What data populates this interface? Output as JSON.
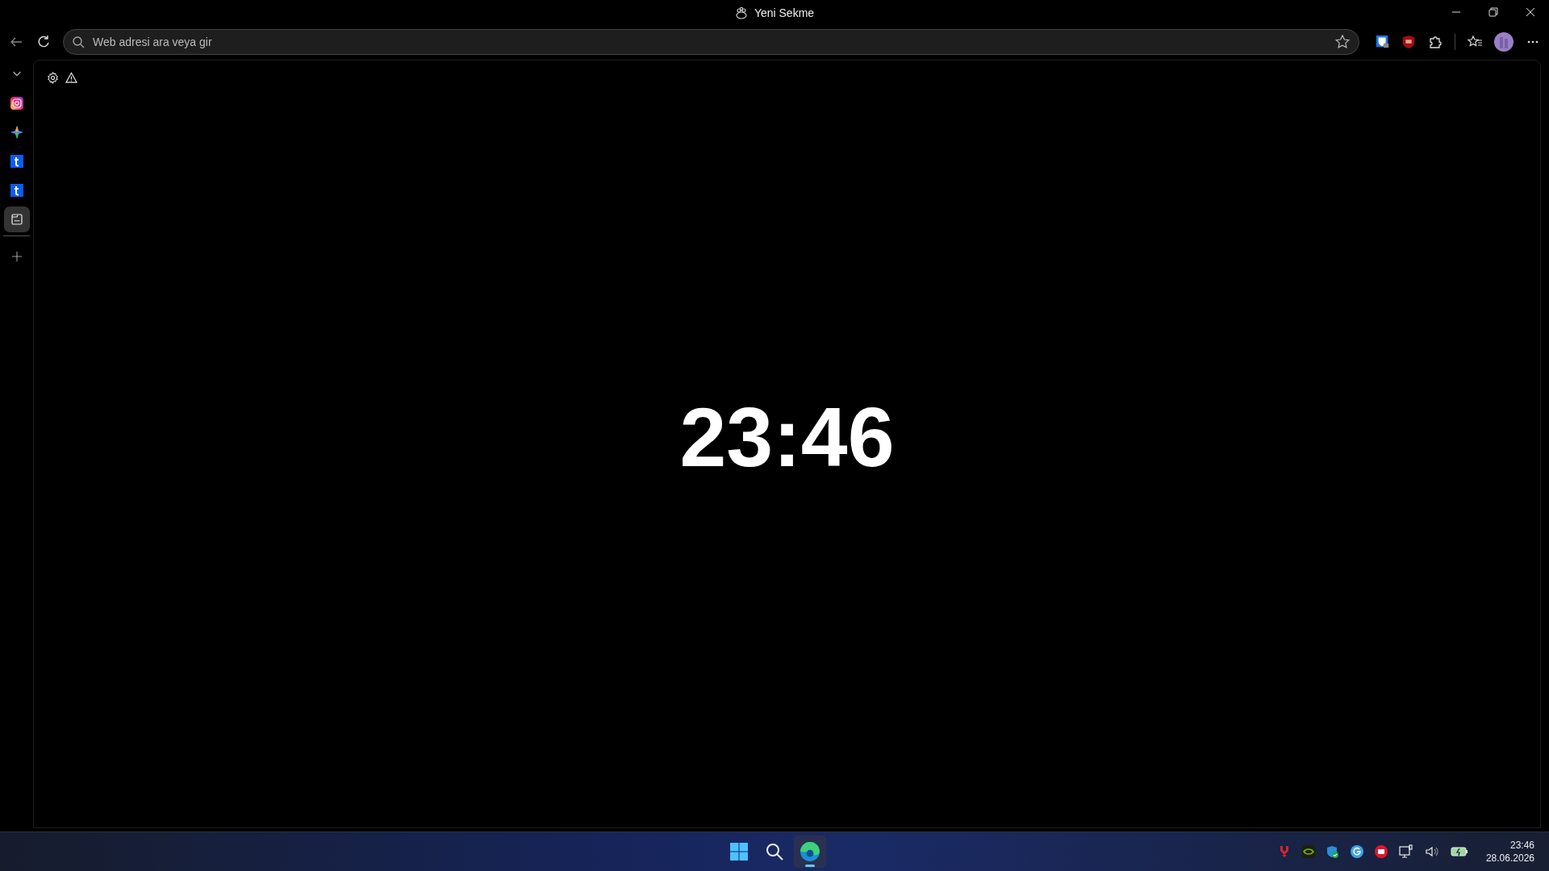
{
  "window": {
    "title": "Yeni Sekme"
  },
  "address_bar": {
    "placeholder": "Web adresi ara veya gir"
  },
  "sidebar": {
    "items": [
      {
        "kind": "instagram",
        "selected": false
      },
      {
        "kind": "sparkle",
        "selected": false
      },
      {
        "kind": "tumblr",
        "selected": false
      },
      {
        "kind": "tumblr",
        "selected": false
      },
      {
        "kind": "panel",
        "selected": true
      }
    ]
  },
  "page": {
    "clock": "23:46"
  },
  "taskbar": {
    "apps": [
      {
        "kind": "start",
        "active": false
      },
      {
        "kind": "search",
        "active": false
      },
      {
        "kind": "edge",
        "active": true
      }
    ],
    "time": "23:46",
    "date": "28.06.2026"
  }
}
